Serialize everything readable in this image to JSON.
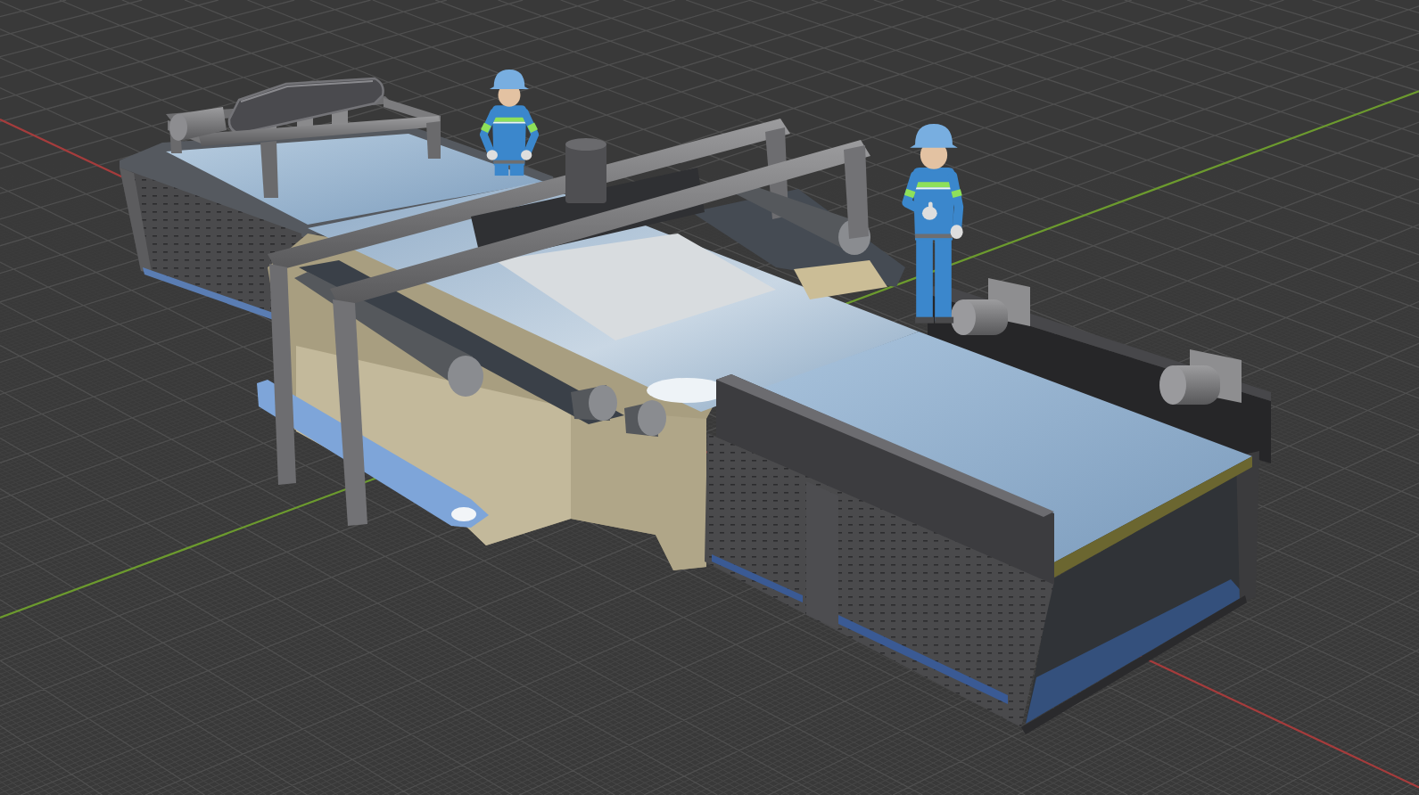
{
  "viewport": {
    "axes": [
      {
        "kind": "x",
        "color": "#a53c3c"
      },
      {
        "kind": "y",
        "color": "#6c9a2e"
      }
    ],
    "objects": [
      {
        "kind": "machine"
      },
      {
        "kind": "worker"
      },
      {
        "kind": "worker"
      }
    ]
  }
}
